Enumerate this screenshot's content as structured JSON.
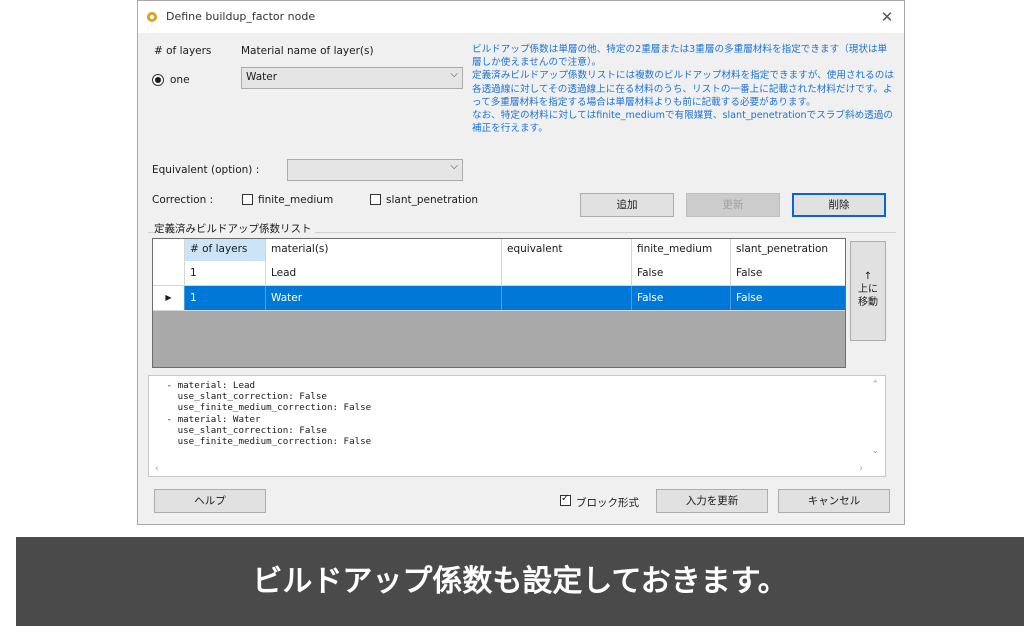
{
  "window": {
    "title": "Define buildup_factor node",
    "close_glyph": "✕"
  },
  "layers": {
    "count_label": "# of layers",
    "material_label": "Material name of layer(s)",
    "radio_label": "one",
    "material_value": "Water"
  },
  "info_text": [
    "ビルドアップ係数は単層の他、特定の2重層または3重層の多重層材料を指定できます（現状は単層しか使えませんので注意）。",
    "定義済みビルドアップ係数リストには複数のビルドアップ材料を指定できますが、使用されるのは各透過線に対してその透過線上に在る材料のうち、リストの一番上に記載された材料だけです。よって多重層材料を指定する場合は単層材料よりも前に記載する必要があります。",
    "なお、特定の材料に対してはfinite_mediumで有限媒質、slant_penetrationでスラブ斜め透過の補正を行えます。"
  ],
  "equivalent": {
    "label": "Equivalent (option) :",
    "value": ""
  },
  "correction": {
    "label": "Correction :",
    "finite_medium": "finite_medium",
    "slant_penetration": "slant_penetration"
  },
  "buttons": {
    "add": "追加",
    "update": "更新",
    "delete": "削除",
    "move_up_arrow": "↑",
    "move_up_1": "上に",
    "move_up_2": "移動",
    "help": "ヘルプ",
    "block_format": "ブロック形式",
    "apply": "入力を更新",
    "cancel": "キャンセル"
  },
  "list": {
    "group_label": "定義済みビルドアップ係数リスト",
    "columns": [
      "# of layers",
      "material(s)",
      "equivalent",
      "finite_medium",
      "slant_penetration"
    ],
    "rows": [
      [
        "1",
        "Lead",
        "",
        "False",
        "False"
      ],
      [
        "1",
        "Water",
        "",
        "False",
        "False"
      ]
    ],
    "selected_marker": "▶"
  },
  "textbox": {
    "content": " - material: Lead\n   use_slant_correction: False\n   use_finite_medium_correction: False\n - material: Water\n   use_slant_correction: False\n   use_finite_medium_correction: False"
  },
  "caption": "ビルドアップ係数も設定しておきます。",
  "colors": {
    "info_text": "#1a73d8",
    "selection": "#0078d7",
    "banner_bg": "#4a4a4a"
  }
}
